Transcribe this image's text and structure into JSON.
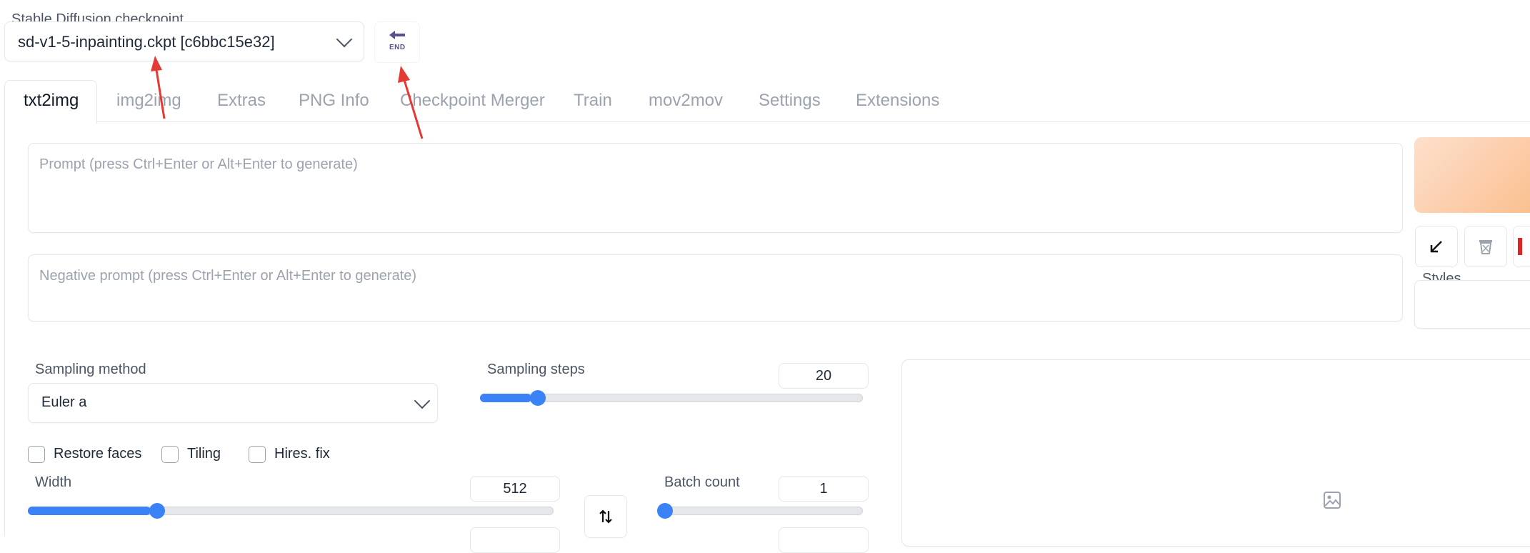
{
  "checkpoint": {
    "label": "Stable Diffusion checkpoint",
    "value": "sd-v1-5-inpainting.ckpt [c6bbc15e32]",
    "refresh_icon_text": "END"
  },
  "tabs": [
    "txt2img",
    "img2img",
    "Extras",
    "PNG Info",
    "Checkpoint Merger",
    "Train",
    "mov2mov",
    "Settings",
    "Extensions"
  ],
  "prompt": {
    "placeholder": "Prompt (press Ctrl+Enter or Alt+Enter to generate)"
  },
  "negative_prompt": {
    "placeholder": "Negative prompt (press Ctrl+Enter or Alt+Enter to generate)"
  },
  "styles": {
    "label": "Styles"
  },
  "sampling_method": {
    "label": "Sampling method",
    "value": "Euler a"
  },
  "sampling_steps": {
    "label": "Sampling steps",
    "value": "20",
    "fraction": 0.135
  },
  "options": {
    "restore_faces": "Restore faces",
    "tiling": "Tiling",
    "hires_fix": "Hires. fix"
  },
  "width": {
    "label": "Width",
    "value": "512",
    "fraction": 0.235
  },
  "batch_count": {
    "label": "Batch count",
    "value": "1",
    "fraction": 0.0
  },
  "colors": {
    "accent": "#3b82f6",
    "annotation_arrow": "#e53935"
  }
}
